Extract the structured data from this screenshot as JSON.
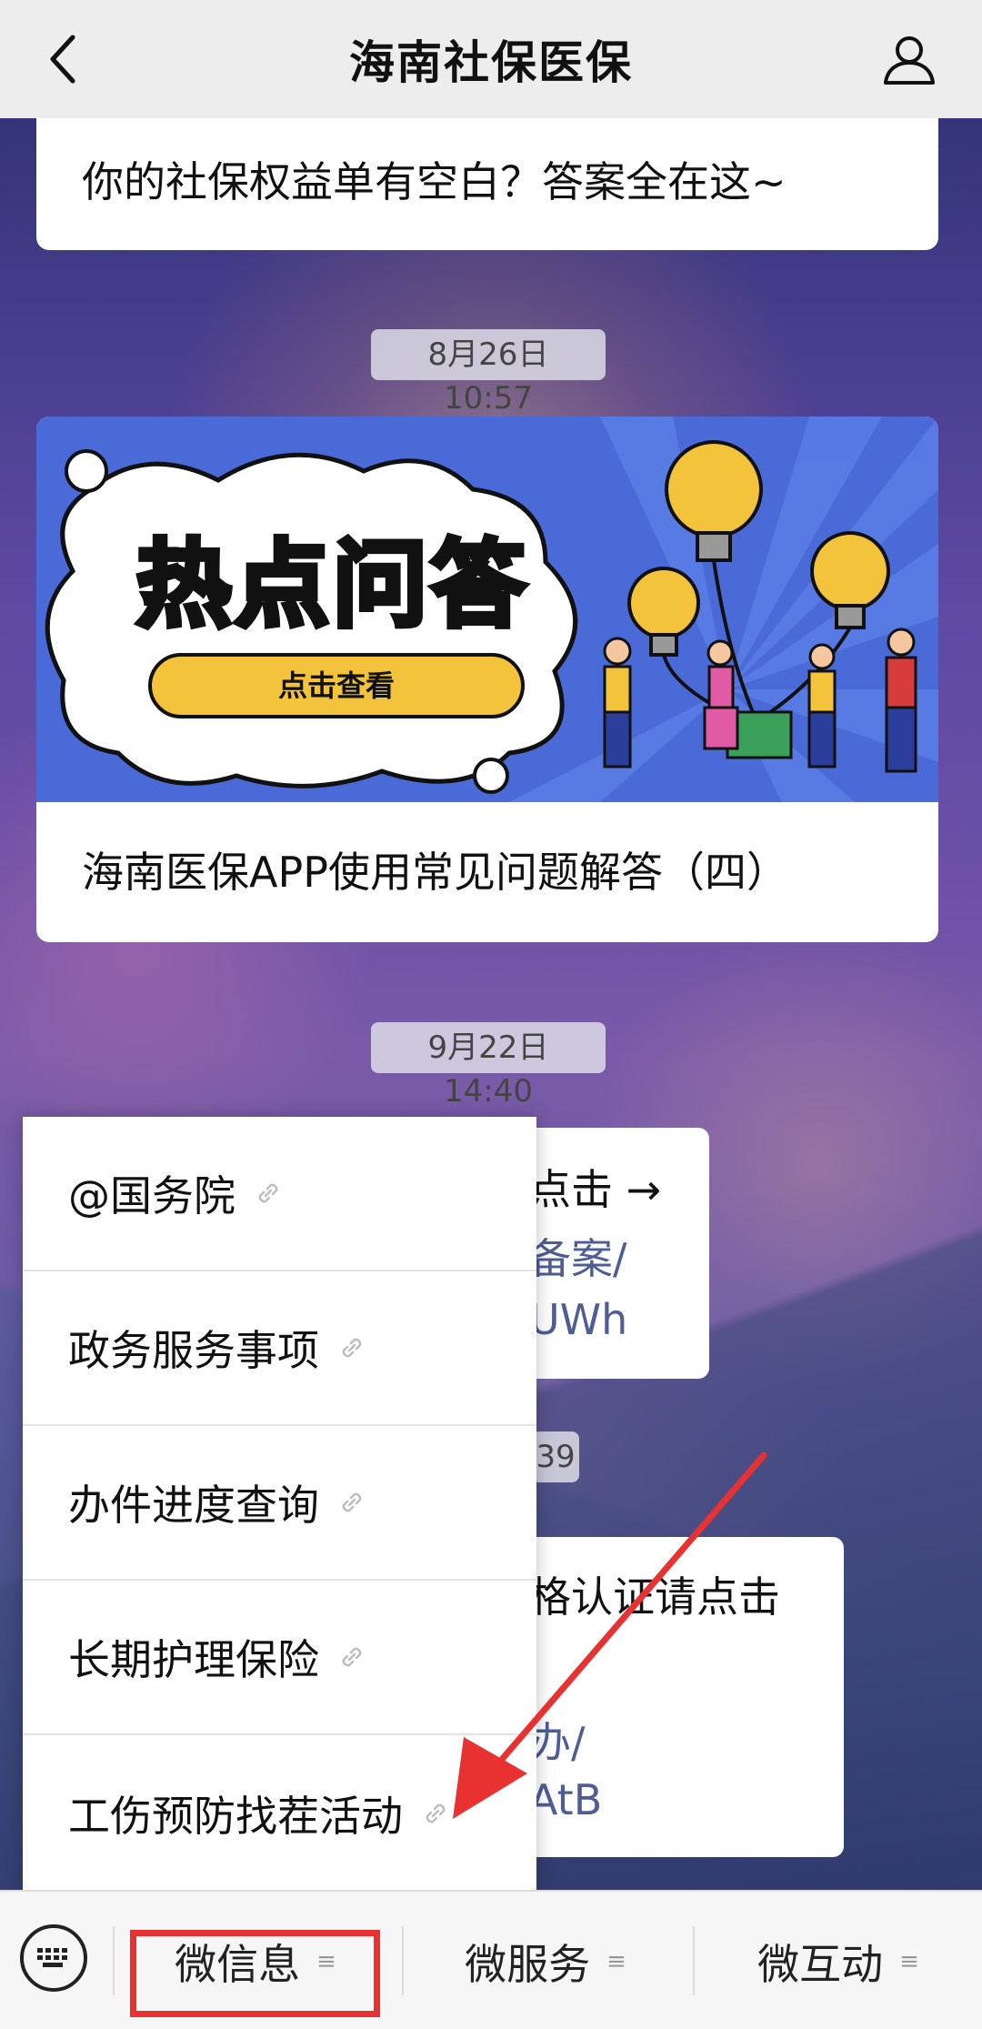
{
  "header": {
    "title": "海南社保医保"
  },
  "messages": [
    {
      "type": "card",
      "text": "你的社保权益单有空白？答案全在这~"
    },
    {
      "type": "timestamp",
      "text": "8月26日 10:57"
    },
    {
      "type": "card",
      "banner_title": "热点问答",
      "banner_button": "点击查看",
      "text": "海南医保APP使用常见问题解答（四）"
    },
    {
      "type": "timestamp",
      "text": "9月22日 14:40"
    }
  ],
  "partial_messages": {
    "msg3_line1": "点击 →",
    "msg3_line2": "备案/",
    "msg3_line3": "UWh",
    "ts3_fragment": "39",
    "msg4_line1": "格认证请点击",
    "msg4_line2": "办/",
    "msg4_line3": "AtB"
  },
  "menu": {
    "items": [
      {
        "label": "@国务院"
      },
      {
        "label": "政务服务事项"
      },
      {
        "label": "办件进度查询"
      },
      {
        "label": "长期护理保险"
      },
      {
        "label": "工伤预防找茬活动"
      }
    ]
  },
  "bottom_tabs": [
    {
      "label": "微信息"
    },
    {
      "label": "微服务"
    },
    {
      "label": "微互动"
    }
  ],
  "colors": {
    "highlight": "#e83232",
    "link_text": "#4e5d93",
    "banner_bg": "#4a6ad8",
    "banner_yellow": "#f3c33b"
  }
}
